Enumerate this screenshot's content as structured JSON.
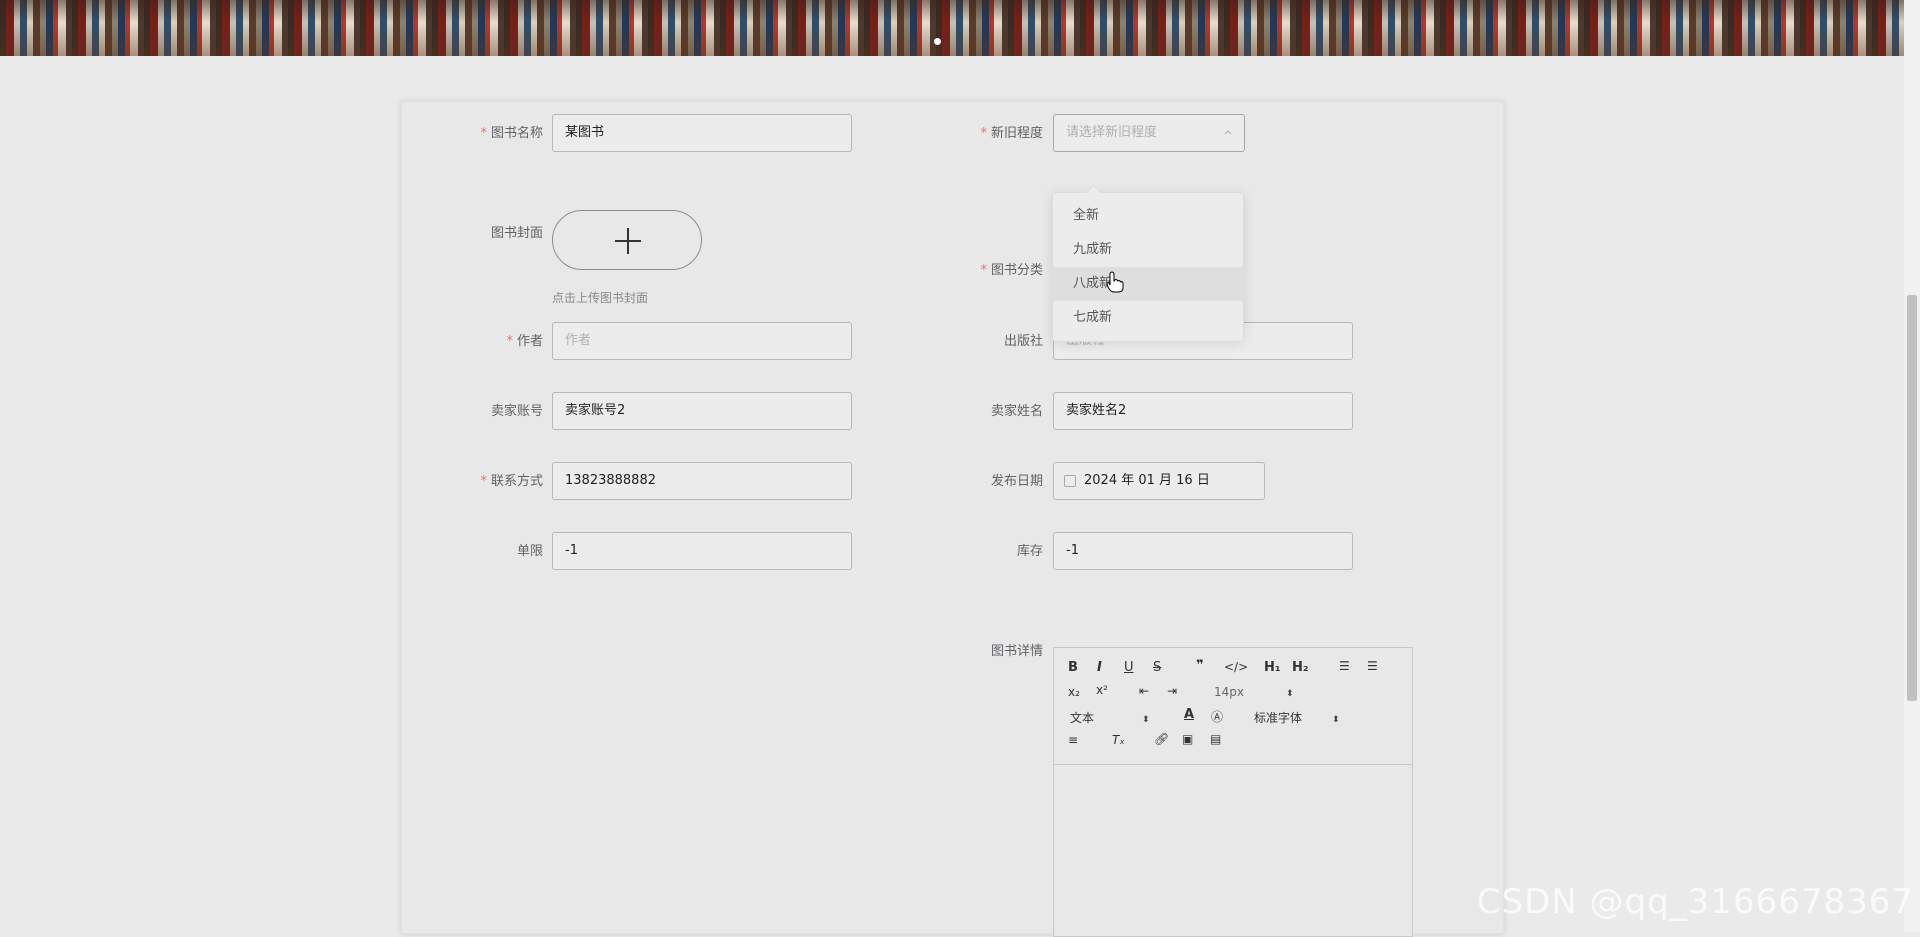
{
  "form": {
    "book_name": {
      "label": "图书名称",
      "value": "某图书",
      "required": true
    },
    "condition": {
      "label": "新旧程度",
      "placeholder": "请选择新旧程度",
      "required": true,
      "options": [
        "全新",
        "九成新",
        "八成新",
        "七成新"
      ],
      "hovered_option": "八成新"
    },
    "cover": {
      "label": "图书封面",
      "hint": "点击上传图书封面"
    },
    "category": {
      "label": "图书分类",
      "required": true
    },
    "author": {
      "label": "作者",
      "placeholder": "作者",
      "required": true
    },
    "publisher": {
      "label": "出版社",
      "placeholder": "出版社"
    },
    "seller_account": {
      "label": "卖家账号",
      "value": "卖家账号2"
    },
    "seller_name": {
      "label": "卖家姓名",
      "value": "卖家姓名2"
    },
    "contact": {
      "label": "联系方式",
      "value": "13823888882",
      "required": true
    },
    "publish_date": {
      "label": "发布日期",
      "value": "2024 年 01 月 16 日"
    },
    "limit": {
      "label": "单限",
      "value": "-1"
    },
    "stock": {
      "label": "库存",
      "value": "-1"
    },
    "details": {
      "label": "图书详情"
    }
  },
  "editor": {
    "font_size": "14px",
    "header_select": "文本",
    "font_family": "标准字体"
  },
  "watermark": "CSDN @qq_3166678367"
}
